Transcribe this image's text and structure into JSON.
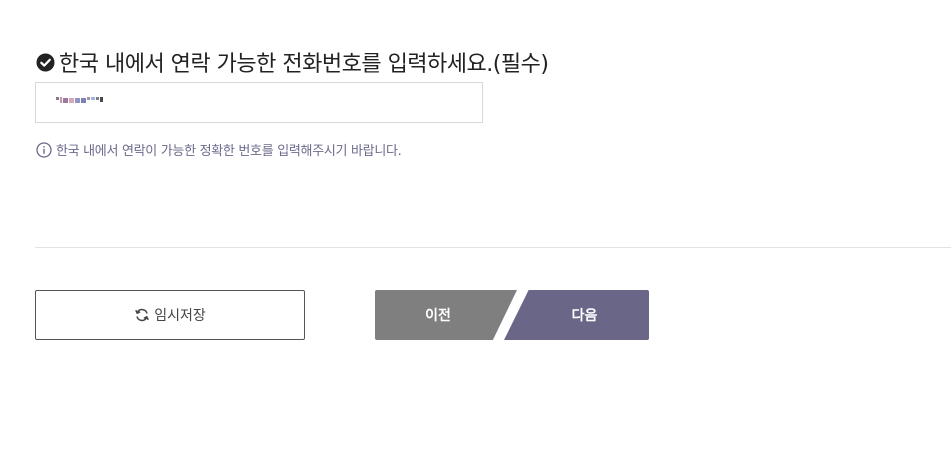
{
  "question": {
    "text": "한국 내에서 연락 가능한 전화번호를 입력하세요.(필수)",
    "icon": "check-circle-icon"
  },
  "phone_input": {
    "value": "",
    "placeholder": ""
  },
  "hint": {
    "text": "한국 내에서 연락이 가능한 정확한 번호를 입력해주시기 바랍니다.",
    "icon": "info-icon"
  },
  "buttons": {
    "save_label": "임시저장",
    "save_icon": "refresh-icon",
    "prev_label": "이전",
    "next_label": "다음"
  },
  "colors": {
    "accent": "#6a6688",
    "prev_bg": "#7f7f7f",
    "hint": "#6b6a8c"
  }
}
